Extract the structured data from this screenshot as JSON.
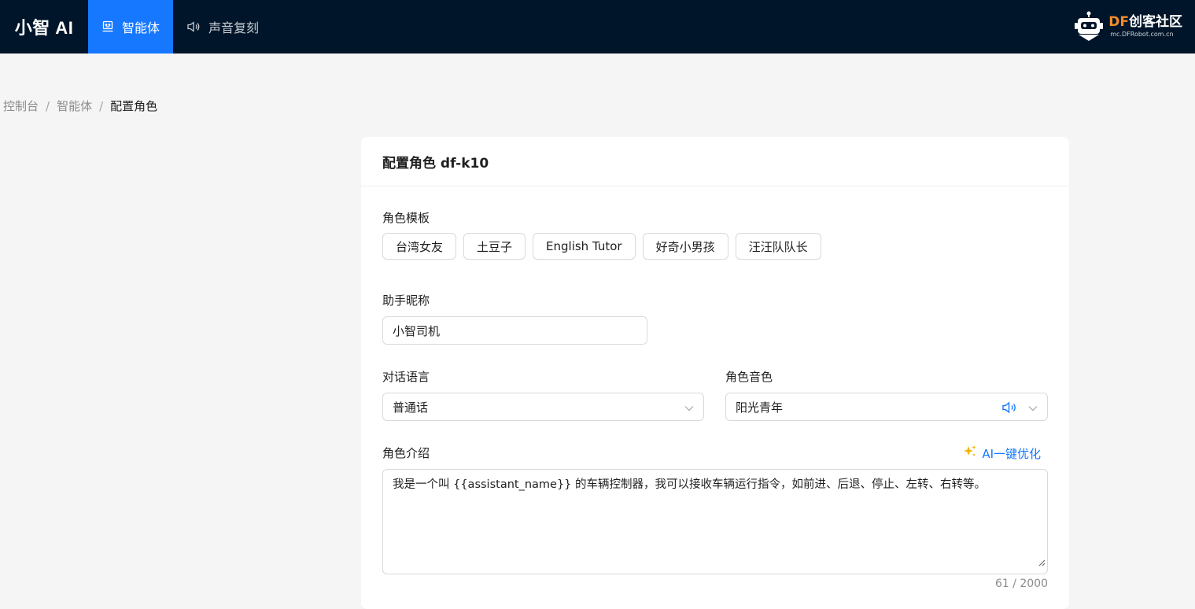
{
  "nav": {
    "brand": "小智 AI",
    "items": [
      {
        "label": "智能体",
        "icon": "robot-icon",
        "active": true
      },
      {
        "label": "声音复刻",
        "icon": "speaker-icon",
        "active": false
      }
    ],
    "logo": {
      "df": "DF",
      "main": "创客社区",
      "sub": "mc.DFRobot.com.cn"
    }
  },
  "breadcrumb": [
    "控制台",
    "智能体",
    "配置角色"
  ],
  "card": {
    "title": "配置角色 df-k10",
    "template_label": "角色模板",
    "templates": [
      "台湾女友",
      "土豆子",
      "English Tutor",
      "好奇小男孩",
      "汪汪队队长"
    ],
    "nickname_label": "助手昵称",
    "nickname_value": "小智司机",
    "language_label": "对话语言",
    "language_value": "普通话",
    "voice_label": "角色音色",
    "voice_value": "阳光青年",
    "intro_label": "角色介绍",
    "ai_optimize": "AI一键优化",
    "ai_optimize_icon": "sparkle-icon",
    "intro_value": "我是一个叫 {{assistant_name}} 的车辆控制器，我可以接收车辆运行指令，如前进、后退、停止、左转、右转等。",
    "intro_count": "61 / 2000"
  },
  "colors": {
    "nav_bg": "#001529",
    "accent": "#1677ff",
    "page_bg": "#f5f5f5"
  }
}
